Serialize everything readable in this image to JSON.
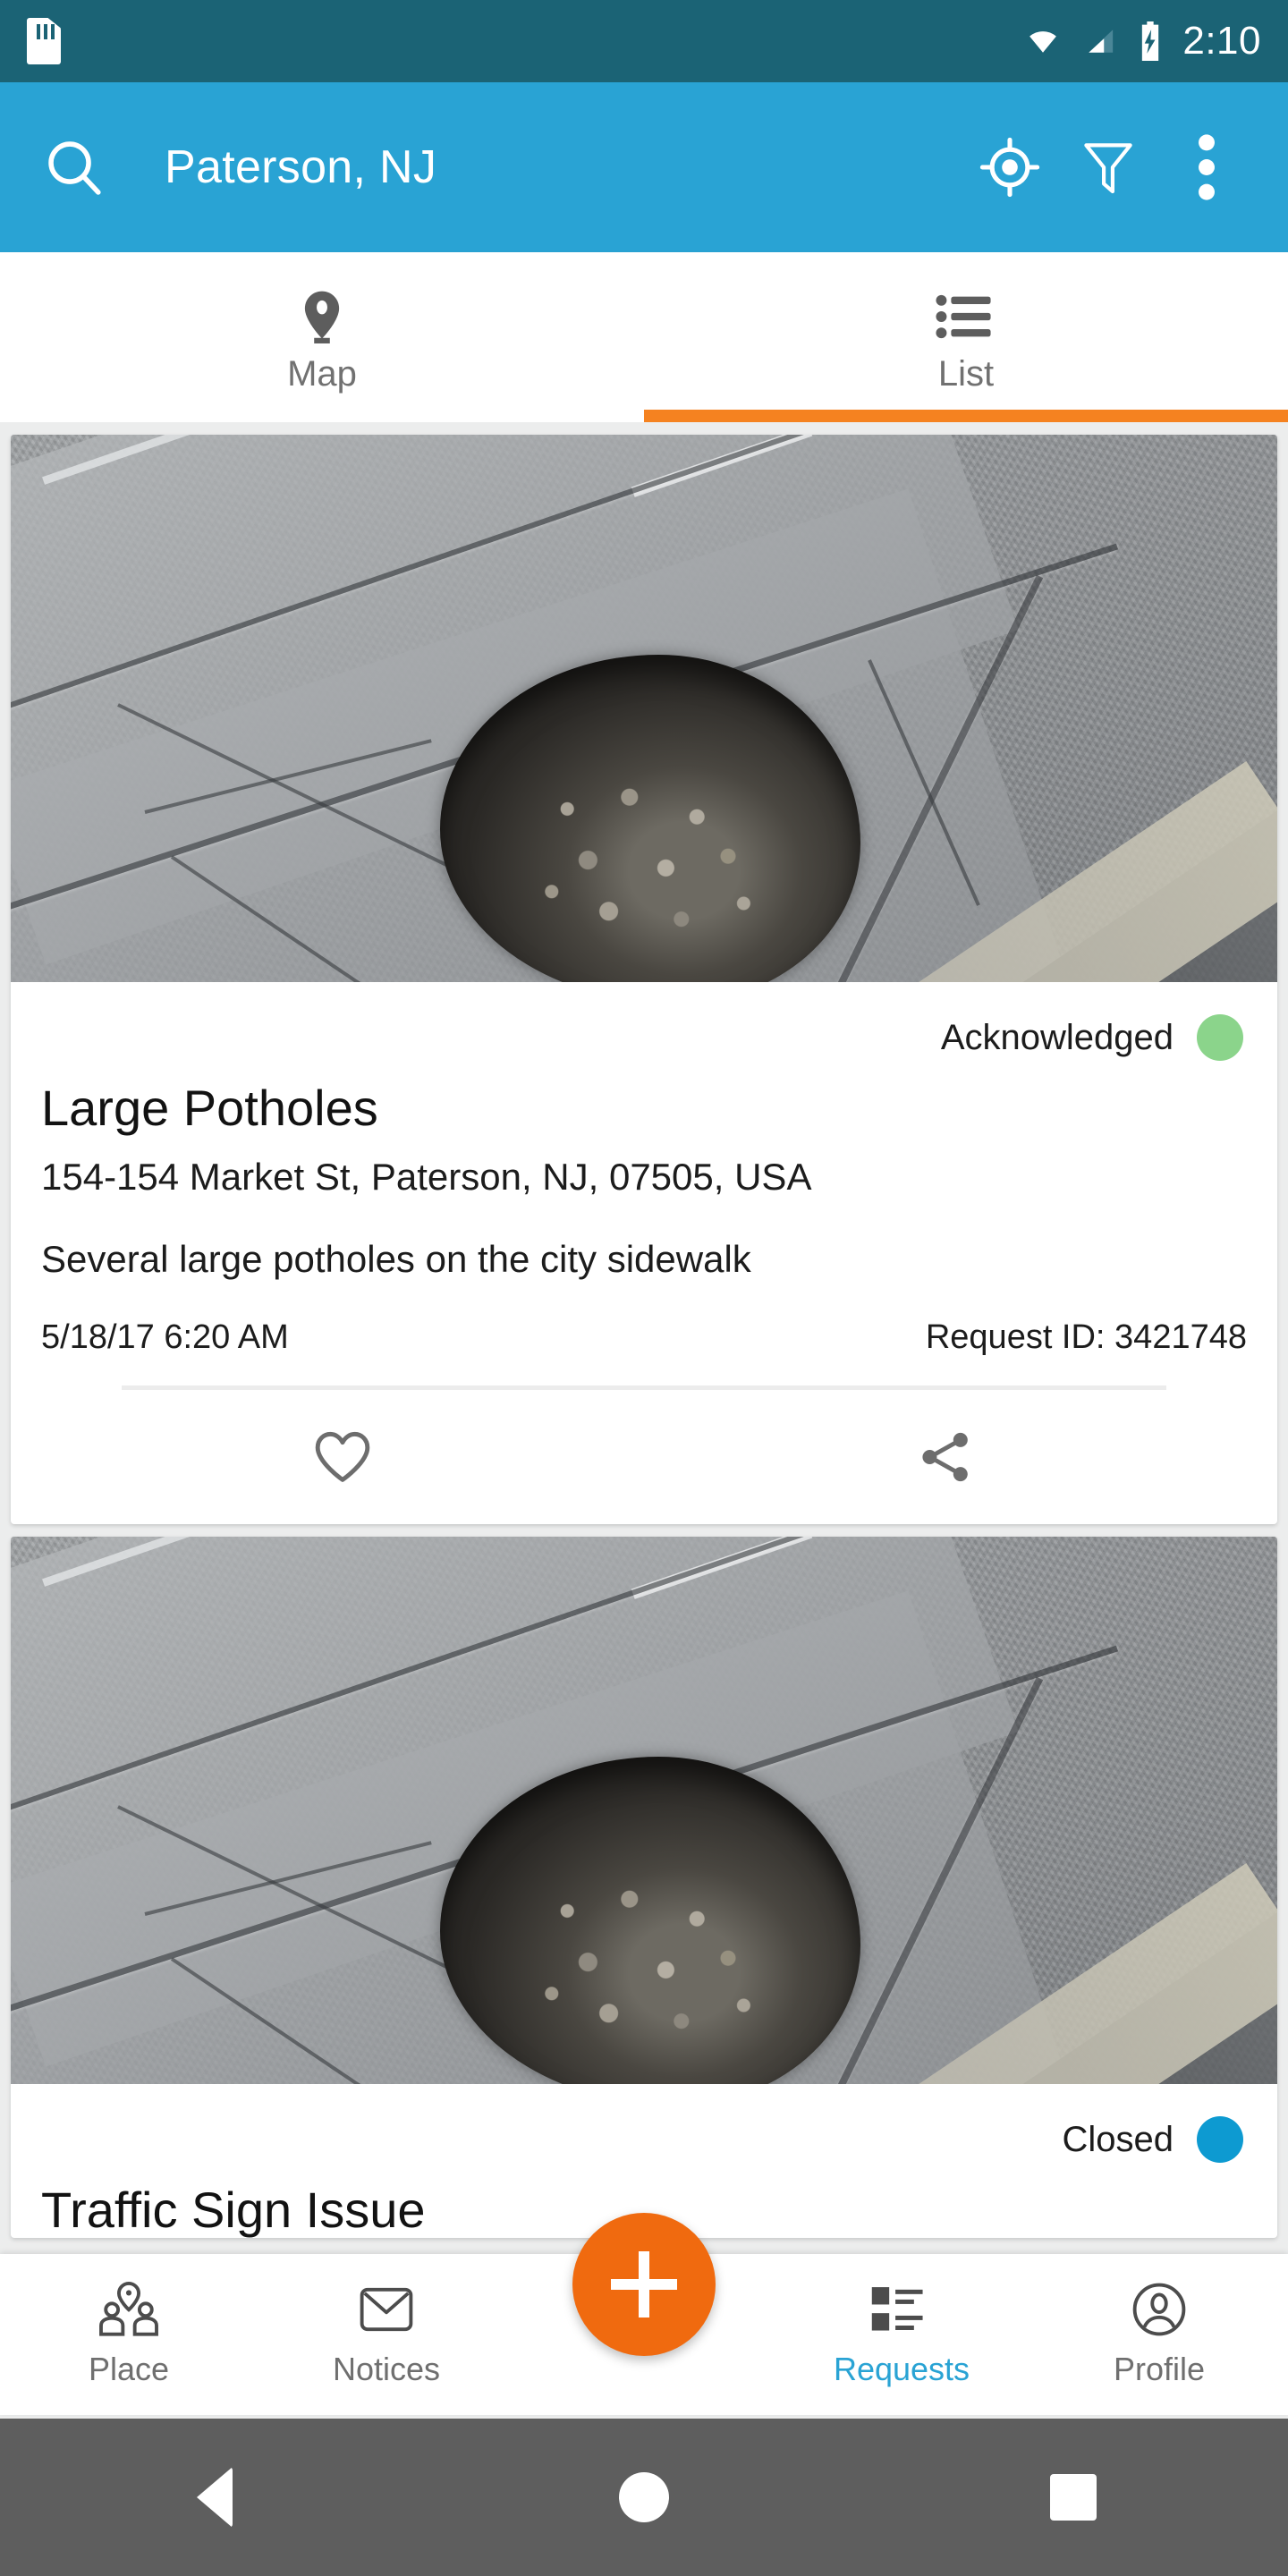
{
  "status_bar": {
    "time": "2:10",
    "icons": [
      "sd-card-icon",
      "wifi-icon",
      "cellular-signal-icon",
      "battery-charging-icon"
    ],
    "background_color": "#1b6375"
  },
  "app_bar": {
    "title": "Paterson, NJ",
    "background_color": "#29a3d4",
    "search_icon": "search-icon",
    "actions": [
      {
        "name": "my-location-icon",
        "label": "My Location"
      },
      {
        "name": "filter-icon",
        "label": "Filter"
      },
      {
        "name": "overflow-menu-icon",
        "label": "More options"
      }
    ]
  },
  "tabs": {
    "active_index": 1,
    "indicator_color": "#f58220",
    "items": [
      {
        "label": "Map",
        "icon": "map-pin-icon",
        "active": false
      },
      {
        "label": "List",
        "icon": "list-icon",
        "active": true
      }
    ]
  },
  "requests": [
    {
      "photo_alt": "Pothole in asphalt road surface",
      "status": "Acknowledged",
      "status_color": "#8bd48b",
      "title": "Large Potholes",
      "address": "154-154 Market St, Paterson, NJ, 07505, USA",
      "description": "Several large potholes on the city sidewalk",
      "timestamp": "5/18/17 6:20 AM",
      "request_id": "Request ID: 3421748",
      "actions": [
        {
          "name": "favorite-icon",
          "label": "Favorite"
        },
        {
          "name": "share-icon",
          "label": "Share"
        }
      ]
    },
    {
      "photo_alt": "Pothole in asphalt road surface",
      "status": "Closed",
      "status_color": "#0d9ad1",
      "title": "Traffic Sign Issue"
    }
  ],
  "bottom_nav": {
    "active": "Requests",
    "active_color": "#29a3d4",
    "fab": {
      "name": "add-request-fab",
      "label": "+",
      "color": "#f06a0f"
    },
    "items": [
      {
        "label": "Place",
        "icon": "place-people-icon",
        "active": false
      },
      {
        "label": "Notices",
        "icon": "envelope-icon",
        "active": false
      },
      {
        "label": "Requests",
        "icon": "requests-list-icon",
        "active": true
      },
      {
        "label": "Profile",
        "icon": "profile-person-icon",
        "active": false
      }
    ]
  },
  "android_nav": {
    "background_color": "#5e5e5e",
    "buttons": [
      {
        "name": "back-button",
        "icon": "triangle-back-icon"
      },
      {
        "name": "home-button",
        "icon": "circle-home-icon"
      },
      {
        "name": "recents-button",
        "icon": "square-recents-icon"
      }
    ]
  }
}
